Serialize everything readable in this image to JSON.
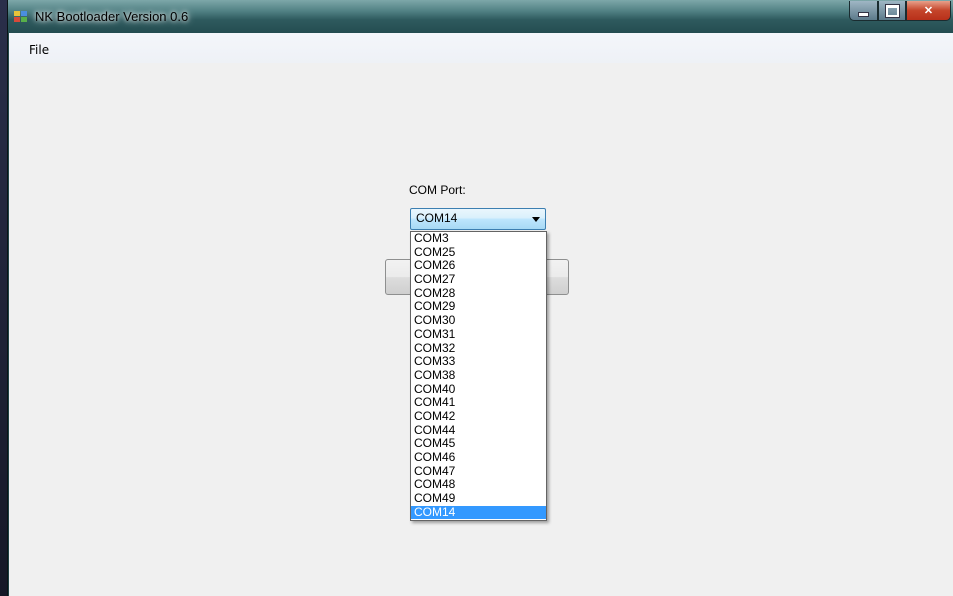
{
  "window": {
    "title": "NK Bootloader Version 0.6"
  },
  "menu": {
    "file_label": "File"
  },
  "com_port": {
    "label": "COM Port:",
    "selected_value": "COM14",
    "options": [
      "COM3",
      "COM25",
      "COM26",
      "COM27",
      "COM28",
      "COM29",
      "COM30",
      "COM31",
      "COM32",
      "COM33",
      "COM38",
      "COM40",
      "COM41",
      "COM42",
      "COM44",
      "COM45",
      "COM46",
      "COM47",
      "COM48",
      "COM49",
      "COM14"
    ],
    "highlighted_option": "COM14"
  },
  "colors": {
    "selection": "#3399ff",
    "client_background": "#f0f0f0",
    "close_button": "#c4442a"
  },
  "icons": {
    "app": "app-window-icon",
    "minimize": "minimize-icon",
    "maximize": "maximize-icon",
    "close": "close-icon",
    "dropdown": "chevron-down-icon"
  }
}
